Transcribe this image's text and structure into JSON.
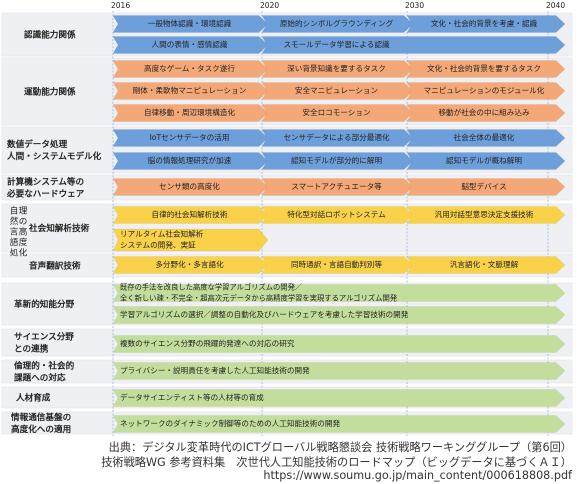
{
  "years": [
    "2016",
    "2020",
    "2030",
    "2040"
  ],
  "colors": {
    "blue": "#6d9fdb",
    "orange": "#f4a877",
    "yellow": "#f9d24a",
    "green": "#c3de9c",
    "row_bg": "#eef0f3",
    "grid": "#8aaad8"
  },
  "rows": [
    {
      "label": "認識能力関係",
      "color": "blue",
      "items": [
        [
          "一般物体認識・環境認識",
          "原始的シンボルグラウンディング",
          "文化・社会的背景を考慮・認識"
        ],
        [
          "人間の表情・感情認識",
          "スモールデータ学習による認識"
        ]
      ]
    },
    {
      "label": "運動能力関係",
      "color": "orange",
      "items": [
        [
          "高度なゲーム・タスク遂行",
          "深い背景知識を要するタスク",
          "文化・社会的背景を要するタスク"
        ],
        [
          "剛体・柔軟物マニピュレーション",
          "安全マニピュレーション",
          "マニピュレーションのモジュール化"
        ],
        [
          "自律移動・周辺環境構造化",
          "安全ロコモーション",
          "移動が社会の中に組み込み"
        ]
      ]
    },
    {
      "label": "数値データ処理 人間・システムモデル化",
      "color": "blue",
      "items": [
        [
          "IoTセンサデータの活用",
          "センサデータによる部分最適化",
          "社会全体の最適化"
        ],
        [
          "脳の情報処理研究が加速",
          "認知モデルが部分的に解明",
          "認知モデルが概ね解明"
        ]
      ]
    },
    {
      "label": "計算機システム等の必要なハードウェア",
      "color": "orange",
      "items": [
        [
          "センサ類の高度化",
          "スマートアクチュエータ等",
          "脳型デバイス"
        ]
      ]
    },
    {
      "label": "社会知解析技術",
      "color": "yellow",
      "items": [
        [
          "自律的社会知解析技術",
          "特化型対話ロボットシステム",
          "汎用対話型意思決定支援技術"
        ],
        [
          "リアルタイム社会知解析システムの開発、実証"
        ]
      ]
    },
    {
      "label": "音声翻訳技術",
      "color": "yellow",
      "items": [
        [
          "多分野化・多言語化",
          "同時通訳・言語自動判別等",
          "汎言語化・文脈理解"
        ]
      ]
    },
    {
      "label": "革新的知能分野",
      "color": "green",
      "items": [
        [
          "既存の手法を改良した高度な学習アルゴリズムの開発／全く新しい疎・不完全・超高次元データから高精度学習を実現するアルゴリズム開発"
        ],
        [
          "学習アルゴリズムの選択／調整の自動化及びハードウェアを考慮した学習技術の開発"
        ]
      ]
    },
    {
      "label": "サイエンス分野との連携",
      "color": "green",
      "items": [
        [
          "複数のサイエンス分野の飛躍的発達への対応の研究"
        ]
      ]
    },
    {
      "label": "倫理的・社会的課題への対応",
      "color": "green",
      "items": [
        [
          "プライバシー・説明責任を考慮した人工知能技術の開発"
        ]
      ]
    },
    {
      "label": "人材育成",
      "color": "green",
      "items": [
        [
          "データサイエンティスト等の人材等の育成"
        ]
      ]
    },
    {
      "label": "情報通信基盤の高度化への適用",
      "color": "green",
      "items": [
        [
          "ネットワークのダイナミック制御等のための人工知能技術の開発"
        ]
      ]
    }
  ],
  "side_label": "自然言語処理の高度化",
  "footer": {
    "line1": "出典：デジタル変革時代のICTグローバル戦略懇談会 技術戦略ワーキンググループ（第6回）",
    "line2": "技術戦略WG 参考資料集　次世代人工知能技術のロードマップ（ビッグデータに基づくＡＩ）",
    "line3": "https://www.soumu.go.jp/main_content/000618808.pdf"
  }
}
